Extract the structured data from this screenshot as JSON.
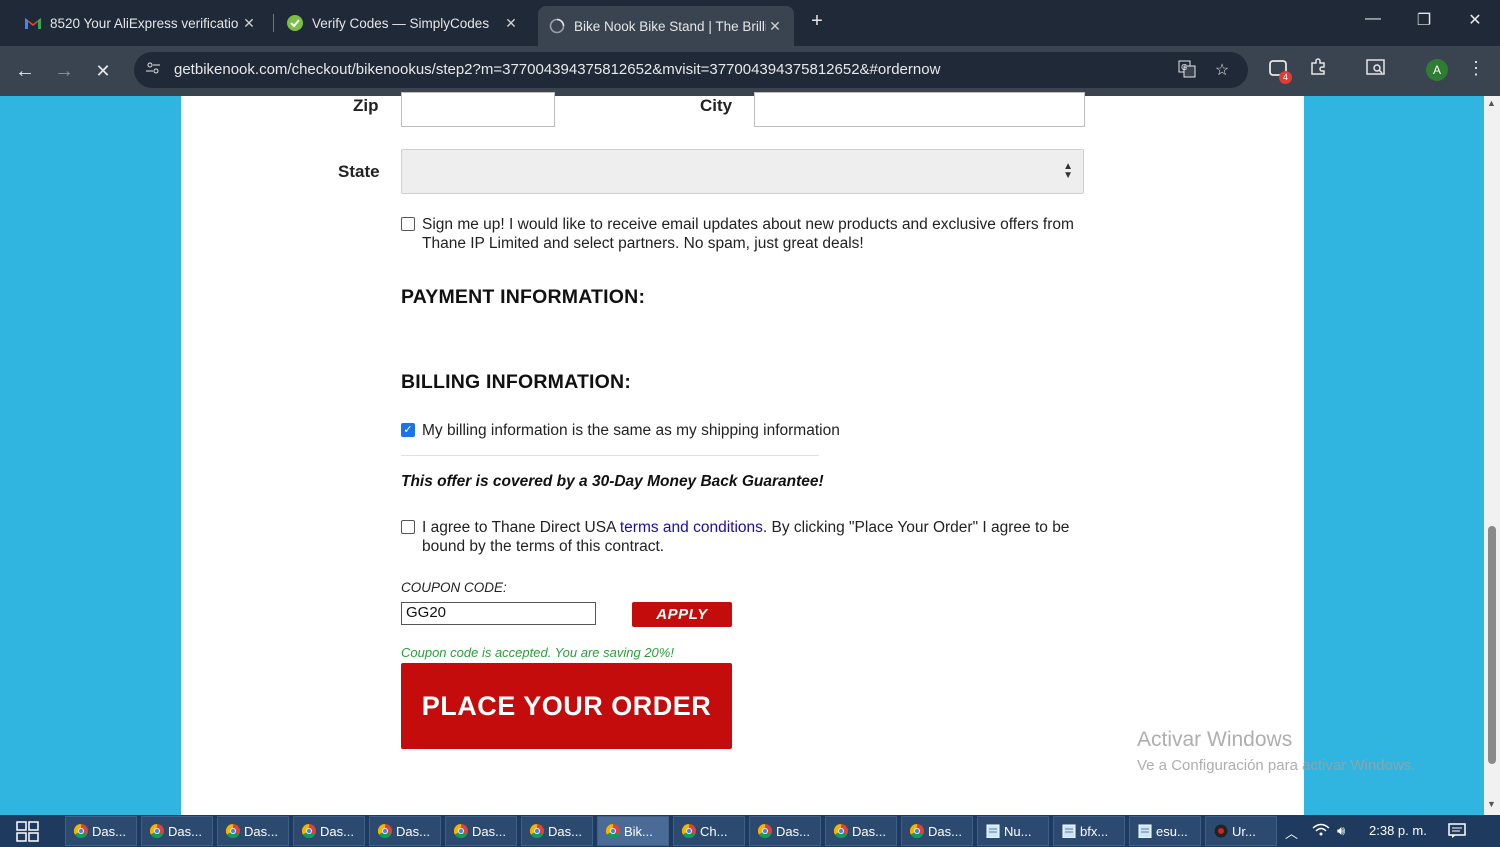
{
  "browser": {
    "tabs": [
      {
        "title": "8520 Your AliExpress verificatio",
        "icon": "gmail-icon"
      },
      {
        "title": "Verify Codes — SimplyCodes",
        "icon": "simplycodes-icon"
      },
      {
        "title": "Bike Nook Bike Stand | The Brilli",
        "icon": "loading-icon",
        "active": true
      }
    ],
    "new_tab": "+",
    "url": "getbikenook.com/checkout/bikenookus/step2?m=377004394375812652&mvisit=377004394375812652&#ordernow",
    "profile_initial": "A",
    "extension_badge": "4"
  },
  "form": {
    "zip_label": "Zip",
    "city_label": "City",
    "state_label": "State",
    "state_value": "",
    "signup_text": "Sign me up! I would like to receive email updates about new products and exclusive offers from Thane IP Limited and select partners. No spam, just great deals!",
    "payment_heading": "PAYMENT INFORMATION:",
    "billing_heading": "BILLING INFORMATION:",
    "billing_same_text": "My billing information is the same as my shipping information",
    "billing_same_checked": true,
    "guarantee_text": "This offer is covered by a 30-Day Money Back Guarantee!",
    "agree_prefix": "I agree to Thane Direct USA ",
    "agree_link": "terms and conditions",
    "agree_suffix": ". By clicking \"Place Your Order\" I agree to be bound by the terms of this contract.",
    "coupon_label": "COUPON CODE:",
    "coupon_value": "GG20",
    "apply_label": "APPLY",
    "coupon_message": "Coupon code is accepted. You are saving 20%!",
    "order_button": "PLACE YOUR ORDER"
  },
  "watermark": {
    "line1": "Activar Windows",
    "line2": "Ve a Configuración para activar Windows."
  },
  "taskbar": {
    "items": [
      {
        "label": "Das...",
        "icon": "chrome-icon"
      },
      {
        "label": "Das...",
        "icon": "chrome-icon"
      },
      {
        "label": "Das...",
        "icon": "chrome-icon"
      },
      {
        "label": "Das...",
        "icon": "chrome-icon"
      },
      {
        "label": "Das...",
        "icon": "chrome-icon"
      },
      {
        "label": "Das...",
        "icon": "chrome-icon"
      },
      {
        "label": "Das...",
        "icon": "chrome-icon"
      },
      {
        "label": "Bik...",
        "icon": "chrome-icon",
        "active": true
      },
      {
        "label": "Ch...",
        "icon": "chrome-icon"
      },
      {
        "label": "Das...",
        "icon": "chrome-icon"
      },
      {
        "label": "Das...",
        "icon": "chrome-icon"
      },
      {
        "label": "Das...",
        "icon": "chrome-icon"
      },
      {
        "label": "Nu...",
        "icon": "notepad-icon"
      },
      {
        "label": "bfx...",
        "icon": "notepad-icon"
      },
      {
        "label": "esu...",
        "icon": "notepad-icon"
      },
      {
        "label": "Ur...",
        "icon": "app-icon"
      }
    ],
    "clock": "2:38 p. m."
  }
}
